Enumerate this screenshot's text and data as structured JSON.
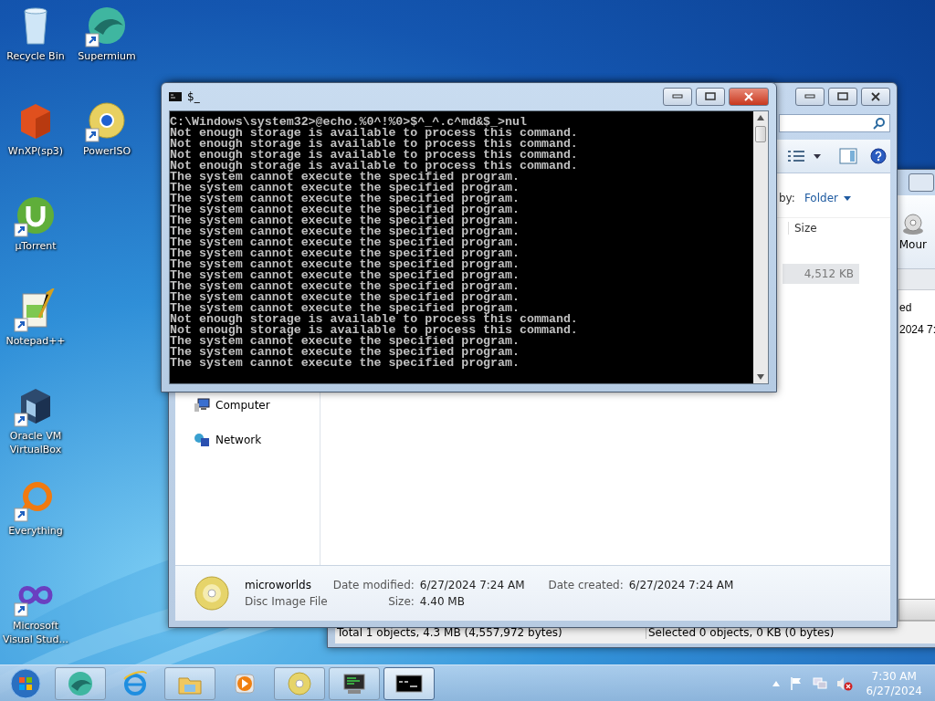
{
  "desktop_icons": [
    {
      "label": "Recycle Bin",
      "shortcut": false
    },
    {
      "label": "WnXP(sp3)",
      "shortcut": false
    },
    {
      "label": "µTorrent",
      "shortcut": true
    },
    {
      "label": "Notepad++",
      "shortcut": true
    },
    {
      "label": "Oracle VM VirtualBox",
      "shortcut": true
    },
    {
      "label": "Everything",
      "shortcut": true
    },
    {
      "label": "Microsoft Visual Stud...",
      "shortcut": true
    },
    {
      "label": "Supermium",
      "shortcut": true
    },
    {
      "label": "PowerISO",
      "shortcut": true
    }
  ],
  "iso_window": {
    "toolbar_button": "Mour",
    "column_header": "ed",
    "cell": "2024 7:",
    "status": [
      "Total 1 objects, 4.3 MB (4,557,972 bytes)",
      "Selected 0 objects, 0 KB (0 bytes)"
    ]
  },
  "explorer": {
    "arrange_label": "by:",
    "arrange_value": "Folder",
    "column": "Size",
    "row_size": "4,512 KB",
    "nav": [
      "Computer",
      "Network"
    ],
    "details": {
      "name": "microworlds",
      "type": "Disc Image File",
      "fields": [
        {
          "label": "Date modified:",
          "value": "6/27/2024 7:24 AM"
        },
        {
          "label": "Date created:",
          "value": "6/27/2024 7:24 AM"
        },
        {
          "label": "Size:",
          "value": "4.40 MB"
        }
      ]
    }
  },
  "console": {
    "title": "$_",
    "lines": [
      "C:\\Windows\\system32>@echo.%0^!%0>$^_^.c^md&$_>nul",
      "Not enough storage is available to process this command.",
      "Not enough storage is available to process this command.",
      "Not enough storage is available to process this command.",
      "Not enough storage is available to process this command.",
      "The system cannot execute the specified program.",
      "The system cannot execute the specified program.",
      "The system cannot execute the specified program.",
      "The system cannot execute the specified program.",
      "The system cannot execute the specified program.",
      "The system cannot execute the specified program.",
      "The system cannot execute the specified program.",
      "The system cannot execute the specified program.",
      "The system cannot execute the specified program.",
      "The system cannot execute the specified program.",
      "The system cannot execute the specified program.",
      "The system cannot execute the specified program.",
      "The system cannot execute the specified program.",
      "Not enough storage is available to process this command.",
      "Not enough storage is available to process this command.",
      "The system cannot execute the specified program.",
      "The system cannot execute the specified program.",
      "The system cannot execute the specified program."
    ]
  },
  "taskbar": {
    "items": [
      {
        "running": true,
        "selected": false
      },
      {
        "running": false,
        "selected": false
      },
      {
        "running": true,
        "selected": false
      },
      {
        "running": false,
        "selected": false
      },
      {
        "running": true,
        "selected": false
      },
      {
        "running": true,
        "selected": false
      },
      {
        "running": true,
        "selected": true
      }
    ],
    "clock": {
      "time": "7:30 AM",
      "date": "6/27/2024"
    }
  }
}
